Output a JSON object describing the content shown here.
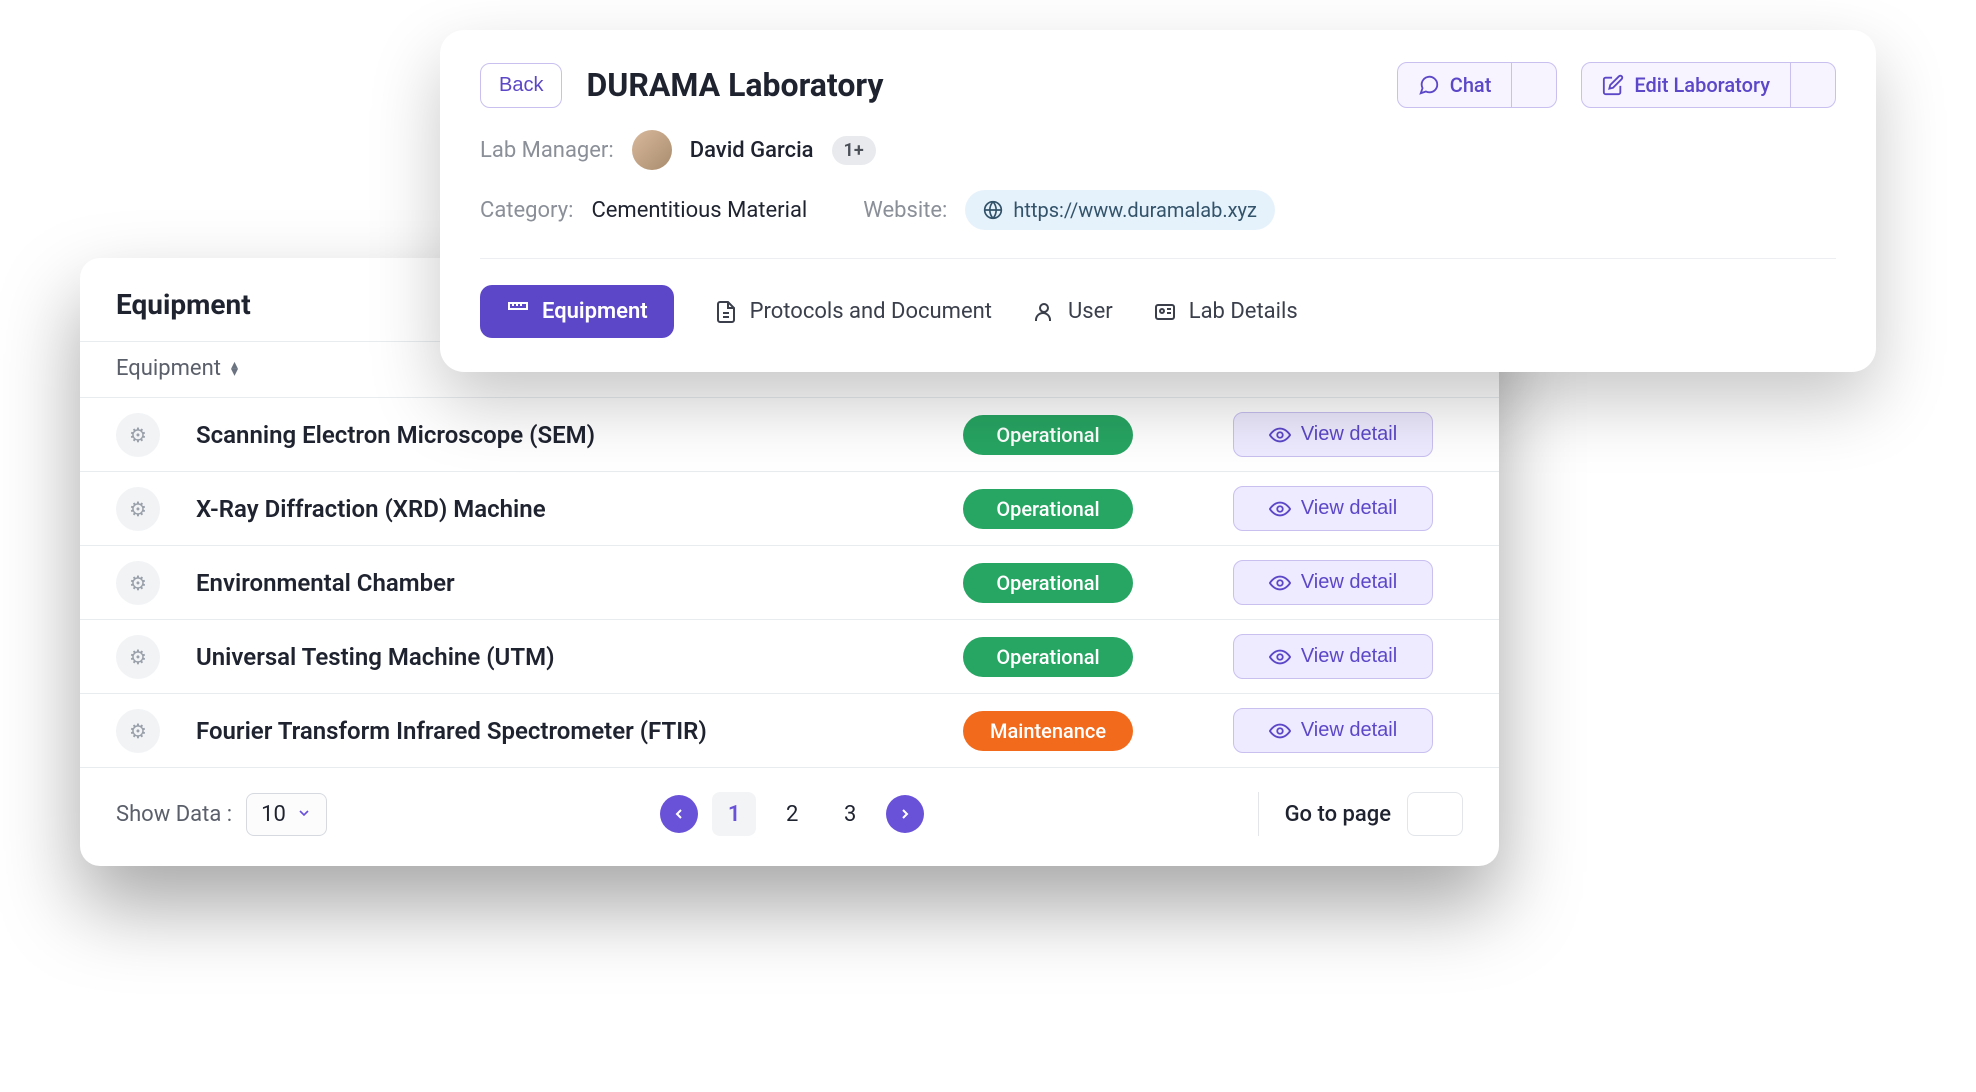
{
  "lab": {
    "back_label": "Back",
    "title": "DURAMA Laboratory",
    "chat_label": "Chat",
    "edit_label": "Edit Laboratory",
    "manager_label": "Lab Manager:",
    "manager_name": "David Garcia",
    "manager_more": "1+",
    "category_label": "Category:",
    "category_value": "Cementitious Material",
    "website_label": "Website:",
    "website_url": "https://www.duramalab.xyz"
  },
  "tabs": [
    {
      "label": "Equipment",
      "active": true
    },
    {
      "label": "Protocols and Document",
      "active": false
    },
    {
      "label": "User",
      "active": false
    },
    {
      "label": "Lab Details",
      "active": false
    }
  ],
  "equipment": {
    "header": "Equipment",
    "sort_label": "Equipment",
    "view_label": "View detail",
    "rows": [
      {
        "name": "Scanning Electron Microscope (SEM)",
        "status": "Operational"
      },
      {
        "name": "X-Ray Diffraction (XRD) Machine",
        "status": "Operational"
      },
      {
        "name": "Environmental Chamber",
        "status": "Operational"
      },
      {
        "name": "Universal Testing Machine (UTM)",
        "status": "Operational"
      },
      {
        "name": "Fourier Transform Infrared Spectrometer (FTIR)",
        "status": "Maintenance"
      }
    ]
  },
  "pagination": {
    "show_label": "Show Data :",
    "page_size": "10",
    "pages": [
      "1",
      "2",
      "3"
    ],
    "current": "1",
    "goto_label": "Go to page"
  },
  "colors": {
    "accent": "#5b47c7",
    "operational": "#27a562",
    "maintenance": "#f26a1b"
  }
}
